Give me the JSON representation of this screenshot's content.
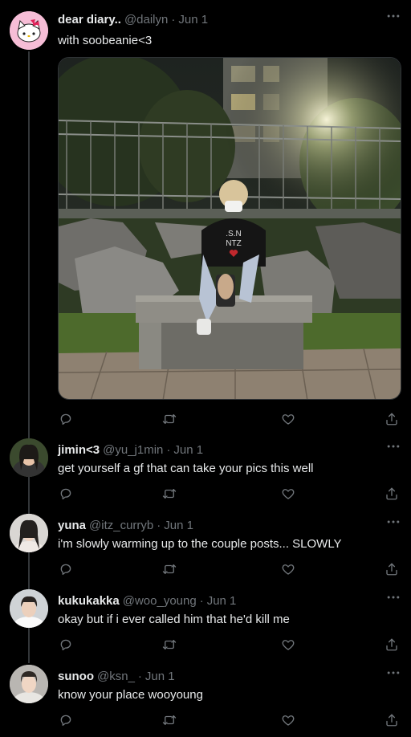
{
  "tweets": [
    {
      "name": "dear diary..",
      "handle": "@dailyn",
      "date": "Jun 1",
      "text": "with soobeanie<3",
      "avatar": "hello-kitty-avatar",
      "media": "photo-person-sitting-on-stone-bench-at-night"
    },
    {
      "name": "jimin<3",
      "handle": "@yu_j1min",
      "date": "Jun 1",
      "text": "get yourself a gf that can take your pics this well",
      "avatar": "person-avatar"
    },
    {
      "name": "yuna",
      "handle": "@itz_curryb",
      "date": "Jun 1",
      "text": "i'm slowly warming up to the couple posts... SLOWLY",
      "avatar": "person-avatar"
    },
    {
      "name": "kukukakka",
      "handle": "@woo_young",
      "date": "Jun 1",
      "text": "okay but if i ever called him that he'd kill me",
      "avatar": "person-avatar"
    },
    {
      "name": "sunoo",
      "handle": "@ksn_",
      "date": "Jun 1",
      "text": "know your place wooyoung",
      "avatar": "person-avatar"
    }
  ],
  "icons": {
    "reply": "reply-icon",
    "retweet": "retweet-icon",
    "like": "heart-icon",
    "share": "share-icon",
    "more": "more-icon"
  },
  "colors": {
    "background": "#000000",
    "text": "#e7e9ea",
    "secondary": "#71767b",
    "line": "#333639"
  }
}
